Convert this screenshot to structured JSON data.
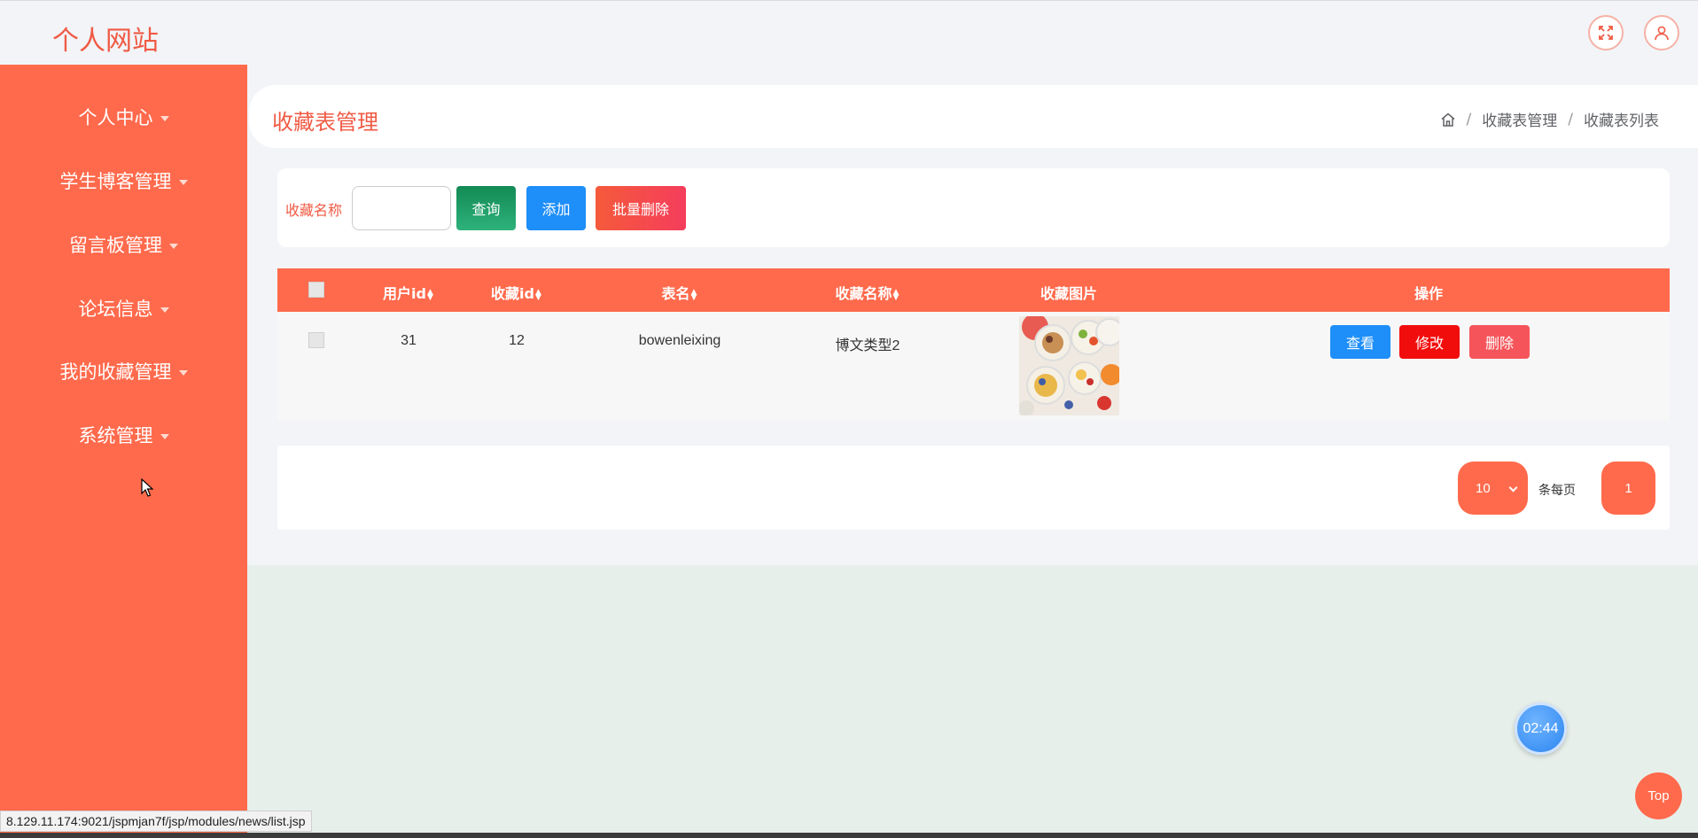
{
  "header": {
    "site_title": "个人网站",
    "fullscreen_icon": "expand-icon",
    "user_icon": "user-icon"
  },
  "sidebar": {
    "items": [
      {
        "label": "个人中心"
      },
      {
        "label": "学生博客管理"
      },
      {
        "label": "留言板管理"
      },
      {
        "label": "论坛信息"
      },
      {
        "label": "我的收藏管理"
      },
      {
        "label": "系统管理"
      }
    ]
  },
  "page": {
    "title": "收藏表管理",
    "breadcrumb": [
      "收藏表管理",
      "收藏表列表"
    ]
  },
  "search": {
    "label": "收藏名称",
    "value": "",
    "query_label": "查询",
    "add_label": "添加",
    "batch_delete_label": "批量删除"
  },
  "table": {
    "columns": [
      "用户id",
      "收藏id",
      "表名",
      "收藏名称",
      "收藏图片",
      "操作"
    ],
    "rows": [
      {
        "user_id": "31",
        "collect_id": "12",
        "table_name": "bowenleixing",
        "collect_name": "博文类型2",
        "image": "food-bowls-image"
      }
    ],
    "actions": {
      "view": "查看",
      "edit": "修改",
      "delete": "删除"
    }
  },
  "pagination": {
    "page_size": "10",
    "per_page_label": "条每页",
    "current_page": "1"
  },
  "widgets": {
    "timer": "02:44",
    "top_label": "Top"
  },
  "status_bar": {
    "url": "8.129.11.174:9021/jspmjan7f/jsp/modules/news/list.jsp"
  },
  "colors": {
    "accent": "#ff6a4c",
    "title": "#f05a44",
    "blue": "#1e8ef9",
    "red": "#f20d0d"
  }
}
